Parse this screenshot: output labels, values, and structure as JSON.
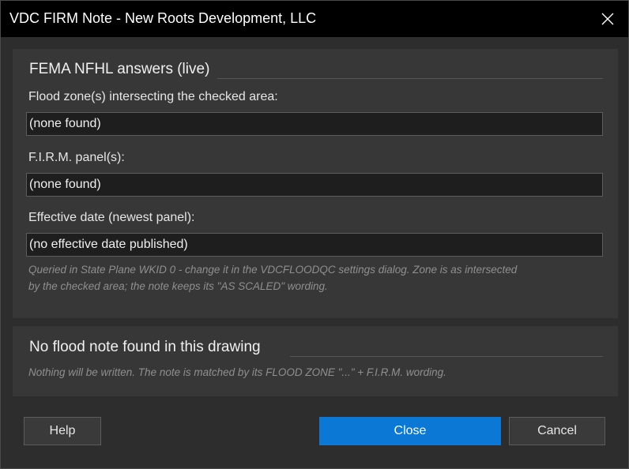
{
  "window": {
    "title": "VDC FIRM Note - New Roots Development, LLC"
  },
  "fema": {
    "section_title": "FEMA NFHL answers (live)",
    "flood_zone_label": "Flood zone(s) intersecting the checked area:",
    "flood_zone_value": "(none found)",
    "panel_label": "F.I.R.M. panel(s):",
    "panel_value": "(none found)",
    "effective_date_label": "Effective date (newest panel):",
    "effective_date_value": "(no effective date published)",
    "hint_line1": "Queried in State Plane WKID 0 - change it in the VDCFLOODQC settings dialog. Zone is as intersected",
    "hint_line2": "by the checked area; the note keeps its \"AS SCALED\" wording."
  },
  "note": {
    "section_title": "No flood note found in this drawing",
    "hint": "Nothing will be written. The note is matched by its FLOOD ZONE \"...\" + F.I.R.M. wording."
  },
  "buttons": {
    "help": "Help",
    "close": "Close",
    "cancel": "Cancel"
  },
  "colors": {
    "accent": "#0a78d4",
    "titlebar": "#000000",
    "background": "#2d2d2d",
    "panel": "#373737",
    "field": "#1e1e1e"
  },
  "icons": {
    "close": "close-icon"
  }
}
